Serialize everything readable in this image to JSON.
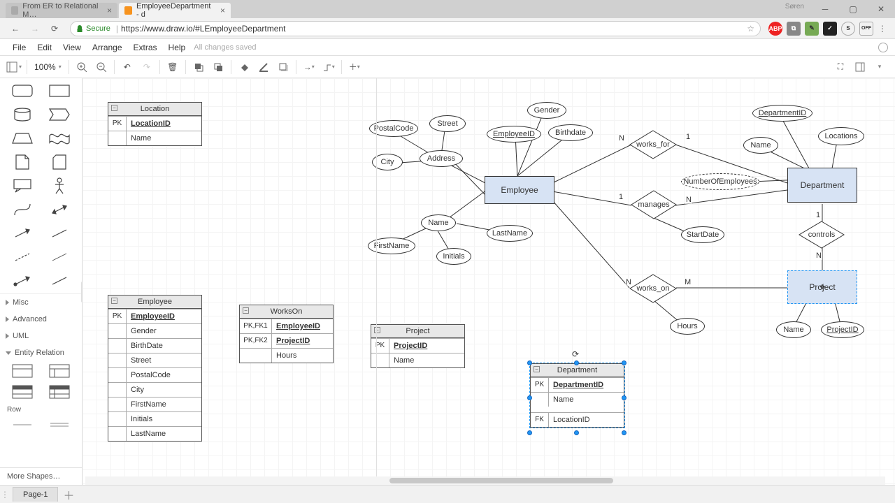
{
  "browser": {
    "tabs": [
      {
        "title": "From ER to Relational M…",
        "active": false
      },
      {
        "title": "EmployeeDepartment - d",
        "active": true
      }
    ],
    "user_label": "Søren",
    "secure_label": "Secure",
    "url": "https://www.draw.io/#LEmployeeDepartment"
  },
  "menu": {
    "items": [
      "File",
      "Edit",
      "View",
      "Arrange",
      "Extras",
      "Help"
    ],
    "status": "All changes saved"
  },
  "toolbar": {
    "zoom": "100%"
  },
  "sidebar": {
    "sections": [
      "Misc",
      "Advanced",
      "UML",
      "Entity Relation"
    ],
    "row_label": "Row",
    "more_shapes": "More Shapes…"
  },
  "tables": {
    "location": {
      "title": "Location",
      "rows": [
        {
          "key": "PK",
          "name": "LocationID",
          "pk": true
        },
        {
          "key": "",
          "name": "Name"
        }
      ]
    },
    "employee": {
      "title": "Employee",
      "rows": [
        {
          "key": "PK",
          "name": "EmployeeID",
          "pk": true
        },
        {
          "key": "",
          "name": "Gender"
        },
        {
          "key": "",
          "name": "BirthDate"
        },
        {
          "key": "",
          "name": "Street"
        },
        {
          "key": "",
          "name": "PostalCode"
        },
        {
          "key": "",
          "name": "City"
        },
        {
          "key": "",
          "name": "FirstName"
        },
        {
          "key": "",
          "name": "Initials"
        },
        {
          "key": "",
          "name": "LastName"
        }
      ]
    },
    "workson": {
      "title": "WorksOn",
      "rows": [
        {
          "key": "PK,FK1",
          "name": "EmployeeID",
          "pk": true
        },
        {
          "key": "PK,FK2",
          "name": "ProjectID",
          "pk": true
        },
        {
          "key": "",
          "name": "Hours"
        }
      ]
    },
    "project": {
      "title": "Project",
      "rows": [
        {
          "key": "PK",
          "name": "ProjectID",
          "pk": true
        },
        {
          "key": "",
          "name": "Name"
        }
      ]
    },
    "department": {
      "title": "Department",
      "rows": [
        {
          "key": "PK",
          "name": "DepartmentID",
          "pk": true
        },
        {
          "key": "",
          "name": "Name"
        },
        {
          "key": "FK",
          "name": "LocationID"
        }
      ]
    }
  },
  "er": {
    "entities": {
      "employee": "Employee",
      "department": "Department",
      "project": "Project"
    },
    "attributes": {
      "postalcode": "PostalCode",
      "street": "Street",
      "city": "City",
      "address": "Address",
      "employeeid": "EmployeeID",
      "gender": "Gender",
      "birthdate": "Birthdate",
      "name_emp": "Name",
      "firstname": "FirstName",
      "lastname": "LastName",
      "initials": "Initials",
      "departmentid": "DepartmentID",
      "locations": "Locations",
      "name_dept": "Name",
      "numberofemployees": "NumberOfEmployees",
      "startdate": "StartDate",
      "hours": "Hours",
      "name_proj": "Name",
      "projectid": "ProjectID"
    },
    "relationships": {
      "works_for": "works_for",
      "manages": "manages",
      "works_on": "works_on",
      "controls": "controls"
    },
    "cardinalities": {
      "wf_emp": "N",
      "wf_dept": "1",
      "mg_emp": "1",
      "mg_dept": "N",
      "wo_emp": "N",
      "wo_proj": "M",
      "ct_dept": "1",
      "ct_proj": "N"
    }
  },
  "footer": {
    "page_tab": "Page-1"
  }
}
